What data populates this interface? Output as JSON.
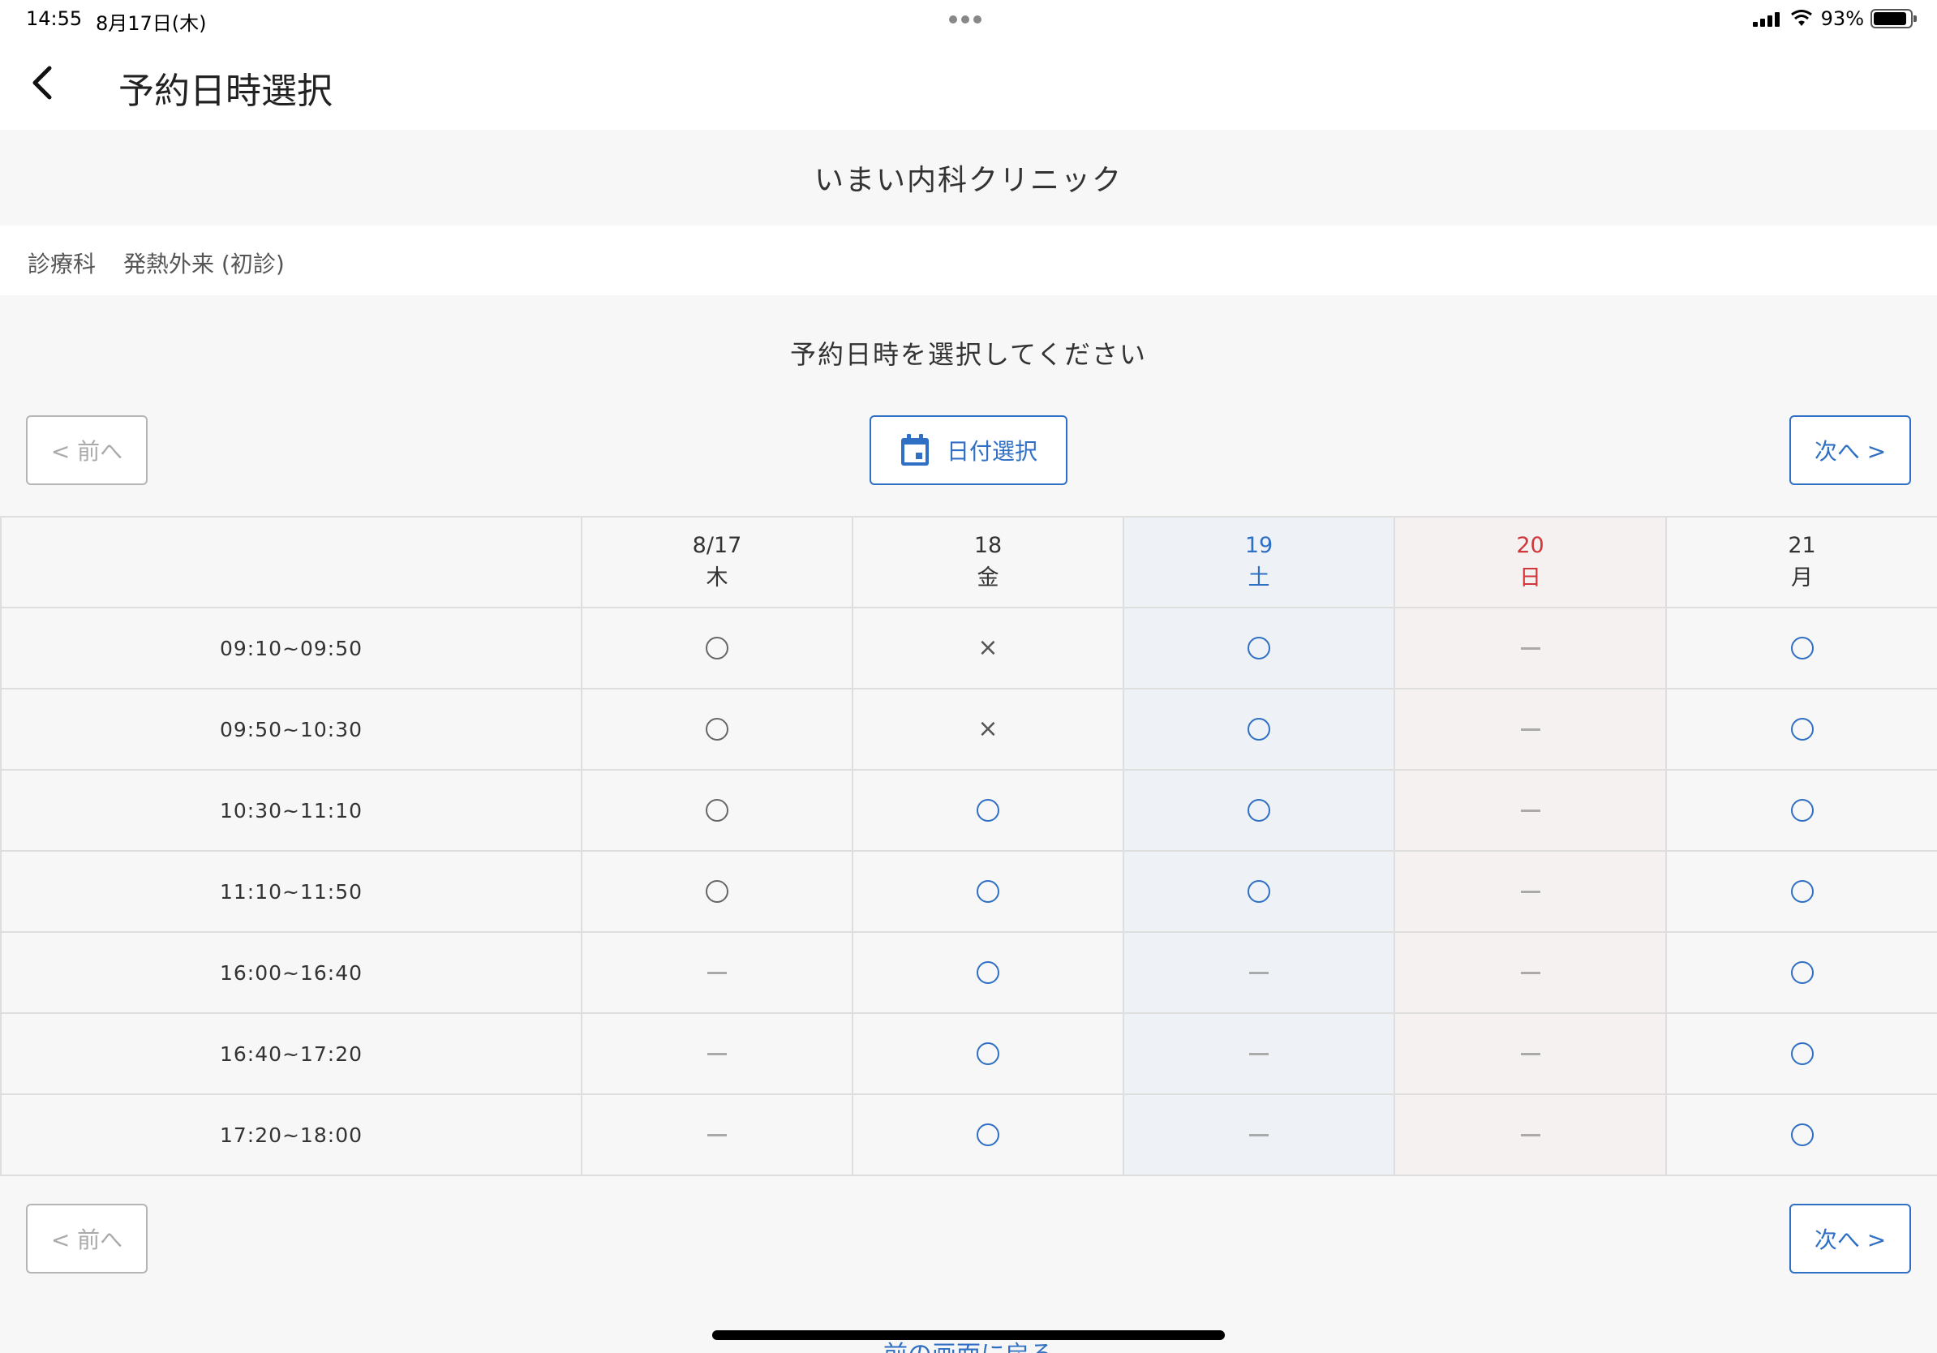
{
  "status_bar": {
    "time": "14:55",
    "date": "8月17日(木)",
    "battery": "93%"
  },
  "header": {
    "title": "予約日時選択"
  },
  "clinic": {
    "name": "いまい内科クリニック"
  },
  "department": {
    "label": "診療科",
    "value": "発熱外来 (初診)"
  },
  "instruction": "予約日時を選択してください",
  "nav": {
    "prev_label": "< 前へ",
    "next_label": "次へ >",
    "date_select_label": "日付選択"
  },
  "days": [
    {
      "date": "8/17",
      "weekday": "木",
      "kind": "weekday"
    },
    {
      "date": "18",
      "weekday": "金",
      "kind": "weekday"
    },
    {
      "date": "19",
      "weekday": "土",
      "kind": "sat"
    },
    {
      "date": "20",
      "weekday": "日",
      "kind": "sun"
    },
    {
      "date": "21",
      "weekday": "月",
      "kind": "weekday"
    }
  ],
  "slots": [
    {
      "time": "09:10~09:50",
      "status": [
        "open-gray",
        "full",
        "open-blue",
        "none",
        "open-blue"
      ]
    },
    {
      "time": "09:50~10:30",
      "status": [
        "open-gray",
        "full",
        "open-blue",
        "none",
        "open-blue"
      ]
    },
    {
      "time": "10:30~11:10",
      "status": [
        "open-gray",
        "open-blue",
        "open-blue",
        "none",
        "open-blue"
      ]
    },
    {
      "time": "11:10~11:50",
      "status": [
        "open-gray",
        "open-blue",
        "open-blue",
        "none",
        "open-blue"
      ]
    },
    {
      "time": "16:00~16:40",
      "status": [
        "none",
        "open-blue",
        "none",
        "none",
        "open-blue"
      ]
    },
    {
      "time": "16:40~17:20",
      "status": [
        "none",
        "open-blue",
        "none",
        "none",
        "open-blue"
      ]
    },
    {
      "time": "17:20~18:00",
      "status": [
        "none",
        "open-blue",
        "none",
        "none",
        "open-blue"
      ]
    }
  ],
  "symbols": {
    "full": "×"
  },
  "footer": {
    "back_link": "前の画面に戻る"
  },
  "colors": {
    "accent": "#2f6fc4",
    "sunday": "#d0363a",
    "saturday_bg": "#eef2f6",
    "sunday_bg": "#f4f1f0"
  }
}
